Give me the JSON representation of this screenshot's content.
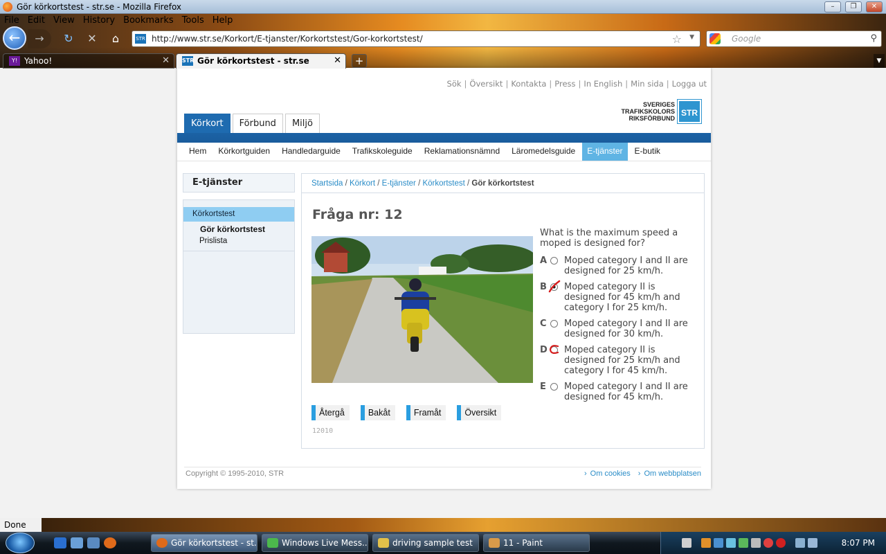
{
  "window": {
    "title": "Gör körkortstest - str.se - Mozilla Firefox"
  },
  "menu": [
    "File",
    "Edit",
    "View",
    "History",
    "Bookmarks",
    "Tools",
    "Help"
  ],
  "url": "http://www.str.se/Korkort/E-tjanster/Korkortstest/Gor-korkortstest/",
  "search_placeholder": "Google",
  "tabs": [
    {
      "label": "Yahoo!"
    },
    {
      "label": "Gör körkortstest - str.se"
    }
  ],
  "toplinks": [
    "Sök",
    "Översikt",
    "Kontakta",
    "Press",
    "In English",
    "Min sida",
    "Logga ut"
  ],
  "logo": {
    "line1": "SVERIGES",
    "line2": "TRAFIKSKOLORS",
    "line3": "RIKSFÖRBUND",
    "mark": "STR"
  },
  "maintabs": [
    "Körkort",
    "Förbund",
    "Miljö"
  ],
  "subnav": [
    "Hem",
    "Körkortguiden",
    "Handledarguide",
    "Trafikskoleguide",
    "Reklamationsnämnd",
    "Läromedelsguide",
    "E-tjänster",
    "E-butik"
  ],
  "sidebar": {
    "heading": "E-tjänster",
    "current": "Körkortstest",
    "items": [
      "Gör körkortstest",
      "Prislista"
    ]
  },
  "breadcrumb": [
    "Startsida",
    "Körkort",
    "E-tjänster",
    "Körkortstest"
  ],
  "breadcrumb_current": "Gör körkortstest",
  "question": {
    "title": "Fråga nr: 12",
    "text": "What is the maximum speed a moped is designed for?",
    "options": [
      {
        "letter": "A",
        "text": "Moped category I and II are designed for 25 km/h."
      },
      {
        "letter": "B",
        "text": "Moped category II is designed for 45 km/h and category I for 25 km/h."
      },
      {
        "letter": "C",
        "text": "Moped category I and II are designed for 30 km/h."
      },
      {
        "letter": "D",
        "text": "Moped category II is designed for 25 km/h and category I for 45 km/h."
      },
      {
        "letter": "E",
        "text": "Moped category I and II are designed for 45 km/h."
      }
    ],
    "id": "12010"
  },
  "buttons": [
    "Återgå",
    "Bakåt",
    "Framåt",
    "Översikt"
  ],
  "footer": {
    "copyright": "Copyright © 1995-2010, STR",
    "links": [
      "Om cookies",
      "Om webbplatsen"
    ]
  },
  "status": "Done",
  "taskbar": {
    "items": [
      "Gör körkortstest - st...",
      "Windows Live Mess...",
      "driving sample test",
      "11 - Paint"
    ],
    "clock": "8:07 PM"
  }
}
